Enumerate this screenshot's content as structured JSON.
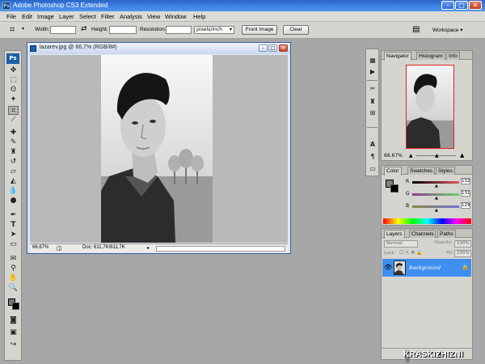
{
  "window": {
    "title": "Adobe Photoshop CS3 Extended",
    "app_icon": "Ps",
    "minimize": "–",
    "maximize": "□",
    "close": "✕"
  },
  "menu": [
    "File",
    "Edit",
    "Image",
    "Layer",
    "Select",
    "Filter",
    "Analysis",
    "View",
    "Window",
    "Help"
  ],
  "options_bar": {
    "width_label": "Width:",
    "width_value": "",
    "height_label": "Height:",
    "height_value": "",
    "resolution_label": "Resolution:",
    "resolution_value": "",
    "unit_value": "pixels/inch",
    "front_image_label": "Front Image",
    "clear_label": "Clear",
    "workspace_label": "Workspace ▾",
    "tool_icon": "crop-icon",
    "swap_icon": "swap-icon"
  },
  "toolbox": {
    "logo": "Ps",
    "tools": [
      "move",
      "marquee",
      "lasso",
      "magic-wand",
      "crop",
      "slice",
      "healing",
      "brush",
      "clone-stamp",
      "history-brush",
      "eraser",
      "gradient",
      "blur",
      "dodge",
      "pen",
      "type",
      "path-select",
      "shape",
      "notes",
      "eyedropper",
      "hand",
      "zoom"
    ],
    "active_tool": "crop"
  },
  "document": {
    "title": "lazarev.jpg @ 66,7% (RGB/8#)",
    "zoom": "66,67%",
    "doc_info": "Doc: 611,7K/611,7K"
  },
  "navigator": {
    "tabs": [
      "Navigator",
      "Histogram",
      "Info"
    ],
    "zoom": "66.67%"
  },
  "color": {
    "tabs": [
      "Color",
      "Swatches",
      "Styles"
    ],
    "channels": [
      {
        "name": "R",
        "value": "132",
        "color": "#c04040"
      },
      {
        "name": "G",
        "value": "131",
        "color": "#40a040"
      },
      {
        "name": "B",
        "value": "129",
        "color": "#4050c0"
      }
    ]
  },
  "layers": {
    "tabs": [
      "Layers",
      "Channels",
      "Paths"
    ],
    "blend_mode": "Normal",
    "opacity_label": "Opacity:",
    "opacity_value": "100%",
    "fill_label": "Fill:",
    "fill_value": "100%",
    "items": [
      {
        "name": "Background",
        "visible": true,
        "locked": true
      }
    ]
  },
  "watermark": "KRASKIZHIZNI"
}
